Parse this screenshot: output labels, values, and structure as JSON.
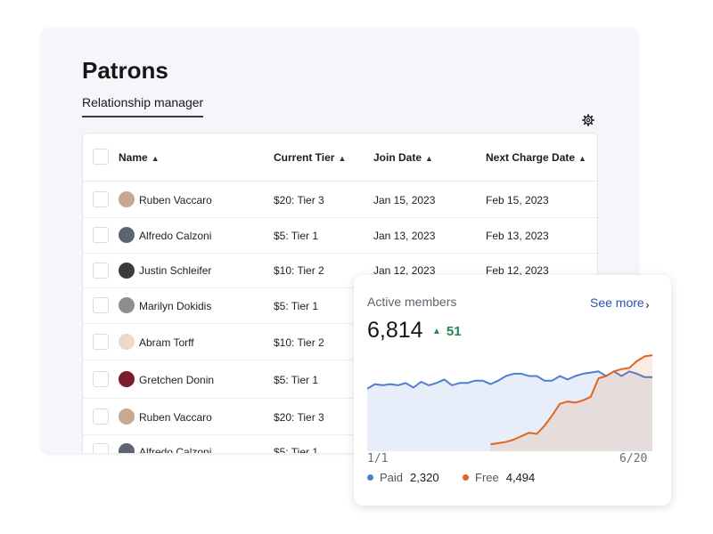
{
  "page": {
    "title": "Patrons",
    "tab_label": "Relationship manager"
  },
  "table": {
    "columns": [
      "Name",
      "Current Tier",
      "Join Date",
      "Next Charge Date"
    ],
    "rows": [
      {
        "name": "Ruben Vaccaro",
        "tier": "$20: Tier 3",
        "join": "Jan 15, 2023",
        "next": "Feb 15, 2023"
      },
      {
        "name": "Alfredo Calzoni",
        "tier": "$5: Tier 1",
        "join": "Jan 13, 2023",
        "next": "Feb 13, 2023"
      },
      {
        "name": "Justin Schleifer",
        "tier": "$10: Tier 2",
        "join": "Jan 12, 2023",
        "next": "Feb 12, 2023"
      },
      {
        "name": "Marilyn Dokidis",
        "tier": "$5: Tier 1",
        "join": "",
        "next": ""
      },
      {
        "name": "Abram Torff",
        "tier": "$10: Tier 2",
        "join": "",
        "next": ""
      },
      {
        "name": "Gretchen Donin",
        "tier": "$5: Tier 1",
        "join": "",
        "next": ""
      },
      {
        "name": "Ruben Vaccaro",
        "tier": "$20: Tier 3",
        "join": "",
        "next": ""
      },
      {
        "name": "Alfredo Calzoni",
        "tier": "$5: Tier 1",
        "join": "",
        "next": ""
      }
    ]
  },
  "active_members": {
    "label": "Active members",
    "see_more": "See more",
    "total": "6,814",
    "delta": "51",
    "x_start": "1/1",
    "x_end": "6/20",
    "legend": [
      {
        "name": "Paid",
        "value": "2,320",
        "color": "#4f7fd0"
      },
      {
        "name": "Free",
        "value": "4,494",
        "color": "#e0651f"
      }
    ]
  },
  "chart_data": {
    "type": "area",
    "x_range": [
      "1/1",
      "6/20"
    ],
    "grid": false,
    "legend_position": "bottom",
    "series": [
      {
        "name": "Paid",
        "color": "#4f7fd0",
        "values": [
          54,
          58,
          57,
          58,
          57,
          59,
          55,
          60,
          57,
          59,
          62,
          57,
          59,
          59,
          61,
          61,
          58,
          61,
          65,
          67,
          67,
          65,
          65,
          61,
          61,
          65,
          62,
          65,
          67,
          68,
          69,
          65,
          69,
          65,
          69,
          67,
          64,
          64
        ]
      },
      {
        "name": "Free",
        "color": "#e0651f",
        "values": [
          null,
          null,
          null,
          null,
          null,
          null,
          null,
          null,
          null,
          null,
          null,
          null,
          null,
          null,
          null,
          null,
          6,
          7,
          8,
          10,
          13,
          16,
          15,
          22,
          31,
          41,
          43,
          42,
          44,
          47,
          63,
          65,
          69,
          71,
          72,
          78,
          82,
          83
        ]
      }
    ]
  }
}
